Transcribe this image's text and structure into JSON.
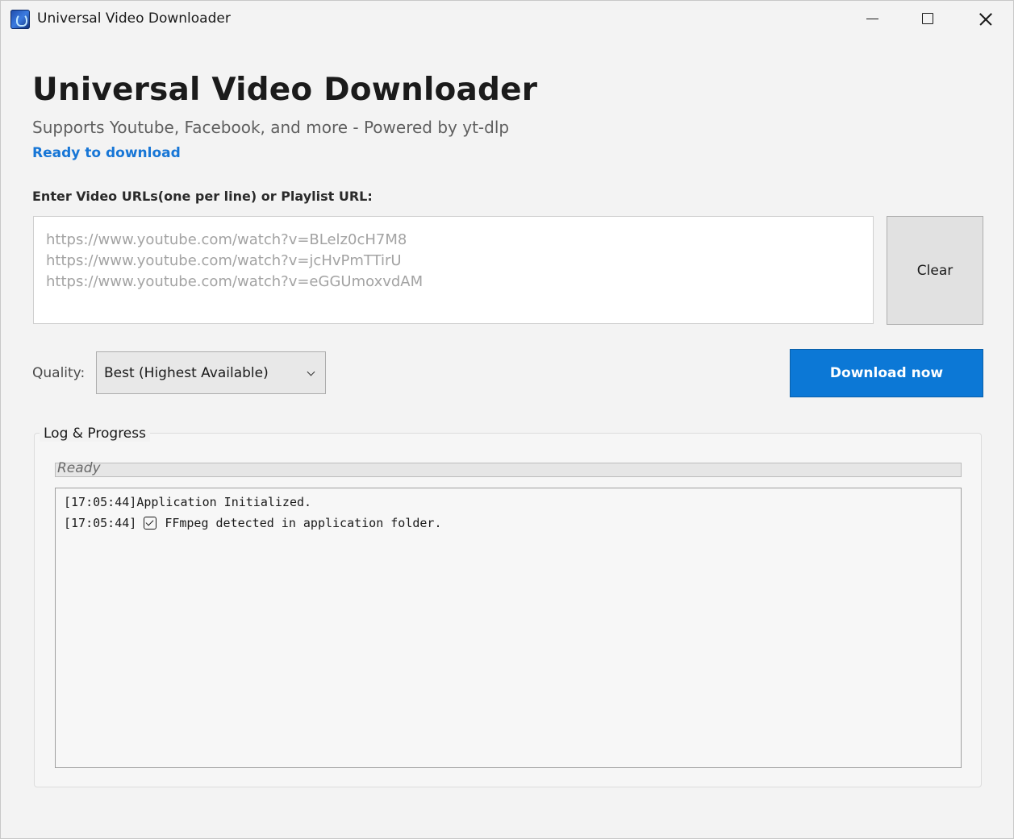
{
  "window": {
    "title": "Universal Video Downloader"
  },
  "header": {
    "title": "Universal Video Downloader",
    "subtitle": "Supports Youtube, Facebook, and more - Powered by yt-dlp",
    "status": "Ready to download"
  },
  "url_section": {
    "label": "Enter Video URLs(one per line) or Playlist URL:",
    "placeholder": "https://www.youtube.com/watch?v=BLelz0cH7M8\nhttps://www.youtube.com/watch?v=jcHvPmTTirU\nhttps://www.youtube.com/watch?v=eGGUmoxvdAM",
    "clear_label": "Clear"
  },
  "quality": {
    "label": "Quality:",
    "selected": "Best (Highest Available)"
  },
  "download": {
    "label": "Download now"
  },
  "log": {
    "title": "Log & Progress",
    "progress_text": "Ready",
    "progress_percent": 0,
    "lines": [
      {
        "time": "[17:05:44]",
        "icon": "",
        "text": "Application Initialized."
      },
      {
        "time": "[17:05:44]",
        "icon": "check-box-icon",
        "text": "FFmpeg detected in application folder."
      }
    ]
  },
  "colors": {
    "accent": "#0c78d6",
    "status": "#1776d6"
  }
}
